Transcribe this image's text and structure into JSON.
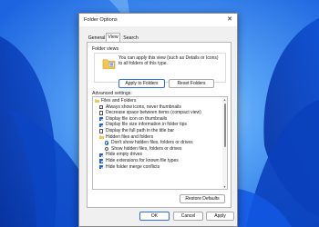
{
  "window": {
    "title": "Folder Options"
  },
  "tabs": [
    {
      "label": "General",
      "active": false
    },
    {
      "label": "View",
      "active": true
    },
    {
      "label": "Search",
      "active": false
    }
  ],
  "folder_views": {
    "heading": "Folder views",
    "description": "You can apply this view (such as Details or Icons) to all folders of this type.",
    "apply_button": "Apply to Folders",
    "reset_button": "Reset Folders"
  },
  "advanced": {
    "heading": "Advanced settings:",
    "items": [
      {
        "kind": "folder",
        "label": "Files and Folders"
      },
      {
        "kind": "checkbox",
        "label": "Always show icons, never thumbnails",
        "checked": false
      },
      {
        "kind": "checkbox",
        "label": "Decrease space between items (compact view)",
        "checked": false
      },
      {
        "kind": "checkbox",
        "label": "Display file icon on thumbnails",
        "checked": true
      },
      {
        "kind": "checkbox",
        "label": "Display file size information in folder tips",
        "checked": true
      },
      {
        "kind": "checkbox",
        "label": "Display the full path in the title bar",
        "checked": false
      },
      {
        "kind": "folder",
        "label": "Hidden files and folders"
      },
      {
        "kind": "radio",
        "label": "Don't show hidden files, folders or drives",
        "checked": true
      },
      {
        "kind": "radio",
        "label": "Show hidden files, folders or drives",
        "checked": false
      },
      {
        "kind": "checkbox",
        "label": "Hide empty drives",
        "checked": true
      },
      {
        "kind": "checkbox",
        "label": "Hide extensions for known file types",
        "checked": true
      },
      {
        "kind": "checkbox",
        "label": "Hide folder merge conflicts",
        "checked": true
      }
    ],
    "restore_button": "Restore Defaults"
  },
  "footer": {
    "ok": "OK",
    "cancel": "Cancel",
    "apply": "Apply"
  },
  "colors": {
    "accent": "#1f5fd6",
    "wallpaper": "#2f7ef0",
    "dialog_bg": "#f0f0f0"
  }
}
